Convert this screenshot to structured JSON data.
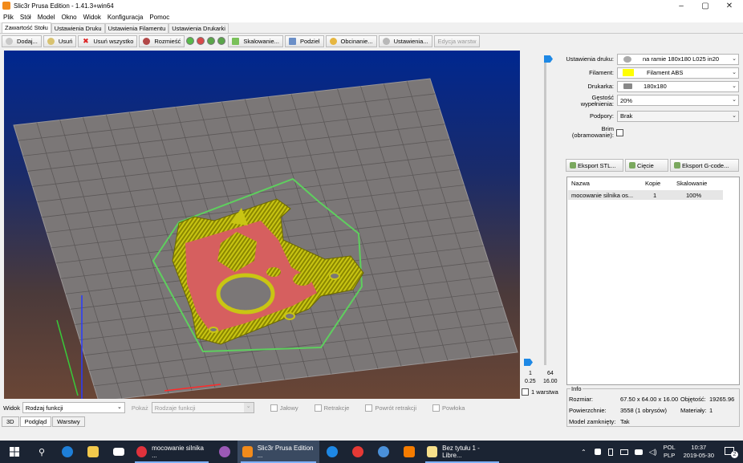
{
  "window": {
    "title": "Slic3r Prusa Edition - 1.41.3+win64",
    "minimize": "–",
    "maximize": "▢",
    "close": "✕"
  },
  "menu": [
    "Plik",
    "Stół",
    "Model",
    "Okno",
    "Widok",
    "Konfiguracja",
    "Pomoc"
  ],
  "tabs": [
    "Zawartość Stołu",
    "Ustawienia Druku",
    "Ustawienia Filamentu",
    "Ustawienia Drukarki"
  ],
  "toolbar": {
    "add": "Dodaj...",
    "remove": "Usuń",
    "remove_all": "Usuń wszystko",
    "arrange": "Rozmieść",
    "scale": "Skalowanie...",
    "split": "Podziel",
    "cut": "Obcinanie...",
    "settings": "Ustawienia...",
    "layer_edit": "Edycja warstw"
  },
  "layer_slider": {
    "top_label": "64",
    "top_value": "16.00",
    "bottom_label": "1",
    "bottom_value": "0.25",
    "one_layer": "1 warstwa"
  },
  "right_panel": {
    "print_settings_label": "Ustawienia druku:",
    "print_settings_value": "na ramie 180x180 L025 in20",
    "filament_label": "Filament:",
    "filament_value": "Filament ABS",
    "filament_color": "#ffff00",
    "printer_label": "Drukarka:",
    "printer_value": "180x180",
    "infill_label_1": "Gęstość",
    "infill_label_2": "wypełnienia:",
    "infill_value": "20%",
    "supports_label": "Podpory:",
    "supports_value": "Brak",
    "brim_label_1": "Brim",
    "brim_label_2": "(obramowanie):",
    "export_stl": "Eksport STL...",
    "slice": "Cięcie",
    "export_gcode": "Eksport G-code..."
  },
  "object_list": {
    "headers": [
      "Nazwa",
      "Kopie",
      "Skalowanie"
    ],
    "rows": [
      {
        "name": "mocowanie silnika os...",
        "copies": "1",
        "scale": "100%"
      }
    ]
  },
  "info": {
    "legend": "Info",
    "size_label": "Rozmiar:",
    "size_value": "67.50 x 64.00 x 16.00",
    "volume_label": "Objętość:",
    "volume_value": "19265.96",
    "facets_label": "Powierzchnie:",
    "facets_value": "3558 (1 obrysów)",
    "materials_label": "Materiały:",
    "materials_value": "1",
    "manifold_label": "Model zamknięty:",
    "manifold_value": "Tak"
  },
  "bottom": {
    "view_label": "Widok",
    "view_value": "Rodzaj funkcji",
    "show_label": "Pokaż",
    "show_value": "Rodzaje funkcji",
    "travel": "Jałowy",
    "retractions": "Retrakcje",
    "unretractions": "Powrót retrakcji",
    "shells": "Powłoka"
  },
  "view_tabs": [
    "3D",
    "Podgląd",
    "Warstwy"
  ],
  "taskbar": {
    "item1": "mocowanie silnika ...",
    "item2": "Slic3r Prusa Edition ...",
    "item3": "Bez tytułu 1 - Libre...",
    "lang1": "POL",
    "lang2": "PLP",
    "time": "10:37",
    "date": "2019-05-30",
    "notif": "2"
  }
}
